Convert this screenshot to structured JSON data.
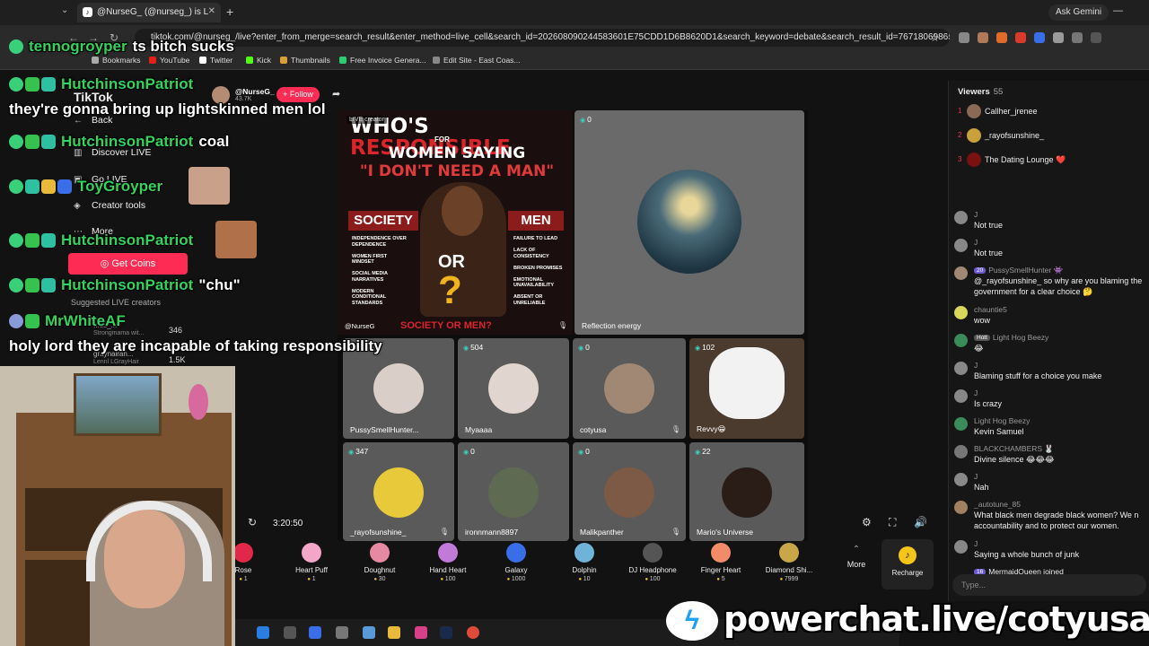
{
  "browser": {
    "tab_title": "@NurseG_ (@nurseg_) is L",
    "url": "tiktok.com/@nurseg_/live?enter_from_merge=search_result&enter_method=live_cell&search_id=2026080902445836​01E75CDD1D6B8620D1&search_keyword=debate&search_result_id=76718069865388306...",
    "ask_gemini": "Ask Gemini",
    "bookmarks": [
      "Bookmarks",
      "YouTube",
      "Twitter",
      "Kick",
      "Thumbnails",
      "Free Invoice Genera...",
      "Edit Site - East Coas..."
    ]
  },
  "tiktok_nav": {
    "logo": "TikTok",
    "back": "Back",
    "discover_live": "Discover LIVE",
    "go_live": "Go LIVE",
    "creator_tools": "Creator tools",
    "more": "More",
    "get_coins": "Get Coins",
    "suggested_title": "Suggested LIVE creators",
    "suggested": [
      {
        "name": "...es_...",
        "sub": "Strongmama wit...",
        "count": "346"
      },
      {
        "name": "graynairan...",
        "sub": "Lennl LGrayHair",
        "count": "1.5K"
      }
    ]
  },
  "streamer": {
    "name": "@NurseG_",
    "likes": "43.7K",
    "follow_label": "+ Follow"
  },
  "poster": {
    "live_tag": "LIVE creator",
    "title_white": "WHO'S",
    "title_red": "RESPONSIBLE",
    "for": "FOR",
    "line2": "WOMEN SAYING",
    "line3": "\"I DON'T NEED A MAN\"",
    "society": "SOCIETY",
    "men": "MEN",
    "society_list": "INDEPENDENCE OVER DEPENDENCE\n\nWOMEN FIRST MINDSET\n\nSOCIAL MEDIA NARRATIVES\n\nMODERN CONDITIONAL STANDARDS",
    "men_list": "FAILURE TO LEAD\n\nLACK OF CONSISTENCY\n\nBROKEN PROMISES\n\nEMOTIONAL UNAVAILABILITY\n\nABSENT OR UNRELIABLE",
    "or": "OR",
    "q": "?",
    "bottom": "SOCIETY OR MEN?",
    "handle": "@NurseG"
  },
  "guests": [
    {
      "name": "Reflection energy",
      "count": "0"
    },
    {
      "name": "PussySmellHunter...",
      "count": ""
    },
    {
      "name": "Myaaaa",
      "count": "504"
    },
    {
      "name": "cotyusa",
      "count": "0"
    },
    {
      "name": "Revvy😁",
      "count": "102"
    },
    {
      "name": "_rayofsunshine_",
      "count": "347"
    },
    {
      "name": "ironnmann8897",
      "count": "0"
    },
    {
      "name": "Malikpanther",
      "count": "0"
    },
    {
      "name": "Mario's Universe",
      "count": "22"
    }
  ],
  "player": {
    "timer": "3:20:50"
  },
  "gifts": [
    {
      "name": "Rose",
      "price": "1",
      "color": "#e0284a"
    },
    {
      "name": "Heart Puff",
      "price": "1",
      "color": "#f3a6c8"
    },
    {
      "name": "Doughnut",
      "price": "30",
      "color": "#e58aa0"
    },
    {
      "name": "Hand Heart",
      "price": "100",
      "color": "#c27ad9"
    },
    {
      "name": "Galaxy",
      "price": "1000",
      "color": "#3a6ee8"
    },
    {
      "name": "Dolphin",
      "price": "10",
      "color": "#6fb3d9"
    },
    {
      "name": "DJ Headphone",
      "price": "100",
      "color": "#333333"
    },
    {
      "name": "Finger Heart",
      "price": "5",
      "color": "#f28b6a"
    },
    {
      "name": "Diamond Shi...",
      "price": "7999",
      "color": "#c9a64a"
    }
  ],
  "gift_more": "More",
  "recharge": "Recharge",
  "viewers": {
    "title": "Viewers",
    "count": "55",
    "top": [
      {
        "rank": "1",
        "name": "Callher_jrenee",
        "color": "#8a6a55"
      },
      {
        "rank": "2",
        "name": "_rayofsunshine_",
        "color": "#c9a13a"
      },
      {
        "rank": "3",
        "name": "The Dating Lounge ❤️",
        "color": "#7a1010"
      }
    ]
  },
  "chat": [
    {
      "user": "J",
      "text": "Not true"
    },
    {
      "user": "J",
      "text": "Not true"
    },
    {
      "user": "PussySmellHunter 👾",
      "badge": "20",
      "text": "@_rayofsunshine_ so why are you blaming the",
      "text2": "government for a clear choice 🤔"
    },
    {
      "user": "chauntie5",
      "text": "wow"
    },
    {
      "user": "Light Hog Beezy",
      "badge": "Hott",
      "text": "😂"
    },
    {
      "user": "J",
      "text": "Blaming stuff for a choice you make"
    },
    {
      "user": "J",
      "text": "Is crazy"
    },
    {
      "user": "Light Hog Beezy",
      "text": "Kevin Samuel"
    },
    {
      "user": "BLACKCHAMBERS 🐰",
      "text": "Divine silence 😂😂😂"
    },
    {
      "user": "J",
      "text": "Nah"
    },
    {
      "user": "_autotune_85",
      "text": "What black men degrade black women? We n",
      "text2": "accountability and to protect our women."
    },
    {
      "user": "J",
      "text": "Saying a whole bunch of junk"
    },
    {
      "user": "",
      "badge": "16",
      "text": "MermaidQueen  joined"
    }
  ],
  "chat_placeholder": "Type...",
  "overlay": [
    {
      "name": "tennogroyper",
      "msg": "ts bitch sucks"
    },
    {
      "name": "HutchinsonPatriot",
      "msg": ""
    },
    {
      "text": "they're gonna bring up lightskinned men lol"
    },
    {
      "name": "HutchinsonPatriot",
      "msg": "coal"
    },
    {
      "name": "ToyGroyper",
      "msg": ""
    },
    {
      "name": "HutchinsonPatriot",
      "msg": ""
    },
    {
      "name": "HutchinsonPatriot",
      "msg": "\"chu\""
    },
    {
      "name": "MrWhiteAF",
      "msg": ""
    },
    {
      "text": "holy lord they are incapable of taking responsibility"
    }
  ],
  "powerchat": "powerchat.live/cotyusa"
}
